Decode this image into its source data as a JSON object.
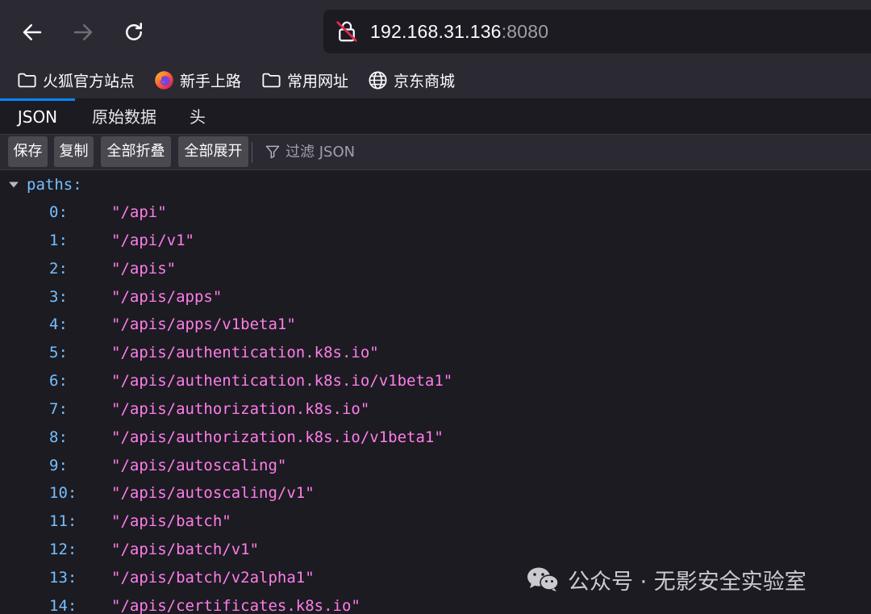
{
  "navbar": {
    "url_host": "192.168.31.136",
    "url_port": ":8080"
  },
  "bookmarks": [
    {
      "label": "火狐官方站点",
      "icon": "folder-icon"
    },
    {
      "label": "新手上路",
      "icon": "firefox-icon"
    },
    {
      "label": "常用网址",
      "icon": "folder-icon"
    },
    {
      "label": "京东商城",
      "icon": "globe-icon"
    }
  ],
  "tabs": [
    {
      "label": "JSON",
      "active": true
    },
    {
      "label": "原始数据",
      "active": false
    },
    {
      "label": "头",
      "active": false
    }
  ],
  "toolbar": {
    "save_label": "保存",
    "copy_label": "复制",
    "collapse_label": "全部折叠",
    "expand_label": "全部展开",
    "filter_placeholder": "过滤 JSON"
  },
  "json": {
    "root_key": "paths:",
    "items": [
      {
        "key": "0:",
        "value": "\"/api\""
      },
      {
        "key": "1:",
        "value": "\"/api/v1\""
      },
      {
        "key": "2:",
        "value": "\"/apis\""
      },
      {
        "key": "3:",
        "value": "\"/apis/apps\""
      },
      {
        "key": "4:",
        "value": "\"/apis/apps/v1beta1\""
      },
      {
        "key": "5:",
        "value": "\"/apis/authentication.k8s.io\""
      },
      {
        "key": "6:",
        "value": "\"/apis/authentication.k8s.io/v1beta1\""
      },
      {
        "key": "7:",
        "value": "\"/apis/authorization.k8s.io\""
      },
      {
        "key": "8:",
        "value": "\"/apis/authorization.k8s.io/v1beta1\""
      },
      {
        "key": "9:",
        "value": "\"/apis/autoscaling\""
      },
      {
        "key": "10:",
        "value": "\"/apis/autoscaling/v1\""
      },
      {
        "key": "11:",
        "value": "\"/apis/batch\""
      },
      {
        "key": "12:",
        "value": "\"/apis/batch/v1\""
      },
      {
        "key": "13:",
        "value": "\"/apis/batch/v2alpha1\""
      },
      {
        "key": "14:",
        "value": "\"/apis/certificates.k8s.io\""
      }
    ]
  },
  "watermark": {
    "text": "公众号 · 无影安全实验室"
  },
  "colors": {
    "key": "#75bfff",
    "string": "#ff7de9",
    "accent": "#0a84ff",
    "chrome": "#2b2a33",
    "content": "#1c1b22"
  }
}
